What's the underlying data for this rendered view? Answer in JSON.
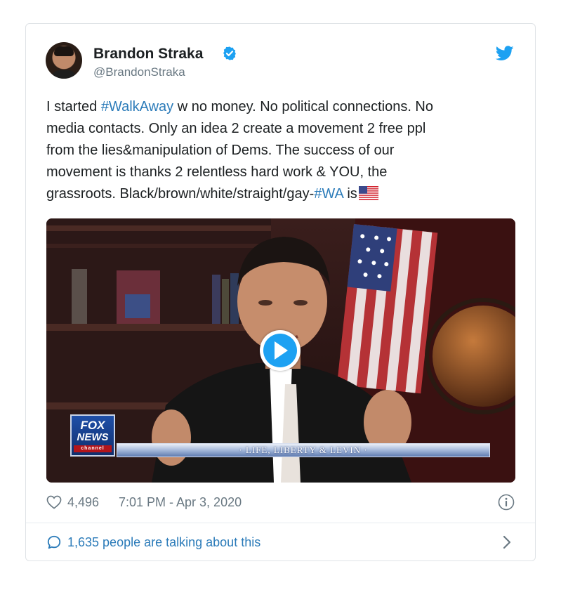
{
  "author": {
    "name": "Brandon Straka",
    "handle": "@BrandonStraka"
  },
  "icons": {
    "verified": "verified-badge-icon",
    "brand": "twitter-bird-icon",
    "like": "heart-icon",
    "info": "info-icon",
    "reply": "speech-bubble-icon",
    "more": "chevron-right-icon",
    "video": "play-icon",
    "emoji": "us-flag-emoji"
  },
  "tweet": {
    "line1_pre": "I started ",
    "line1_tag": "#WalkAway",
    "line1_post": " w no money. No political connections. No",
    "line2": "media contacts. Only an idea 2 create a movement 2 free ppl",
    "line3": "from the lies&manipulation of Dems. The success of our",
    "line4": "movement is thanks 2 relentless hard work & YOU, the",
    "line5_pre": "grassroots. Black/brown/white/straight/gay-",
    "line5_tag": "#WA",
    "line5_post": " is"
  },
  "media": {
    "logo_line1": "FOX",
    "logo_line2": "NEWS",
    "logo_line3": "channel",
    "chyron": "· LIFE, LIBERTY & LEVIN ·"
  },
  "meta": {
    "likes": "4,496",
    "timestamp": "7:01 PM - Apr 3, 2020"
  },
  "footer": {
    "talking": "1,635 people are talking about this"
  },
  "colors": {
    "link": "#2b7bb9",
    "twitter_blue": "#1da1f2",
    "muted": "#697882",
    "border": "#dfe3e6"
  }
}
